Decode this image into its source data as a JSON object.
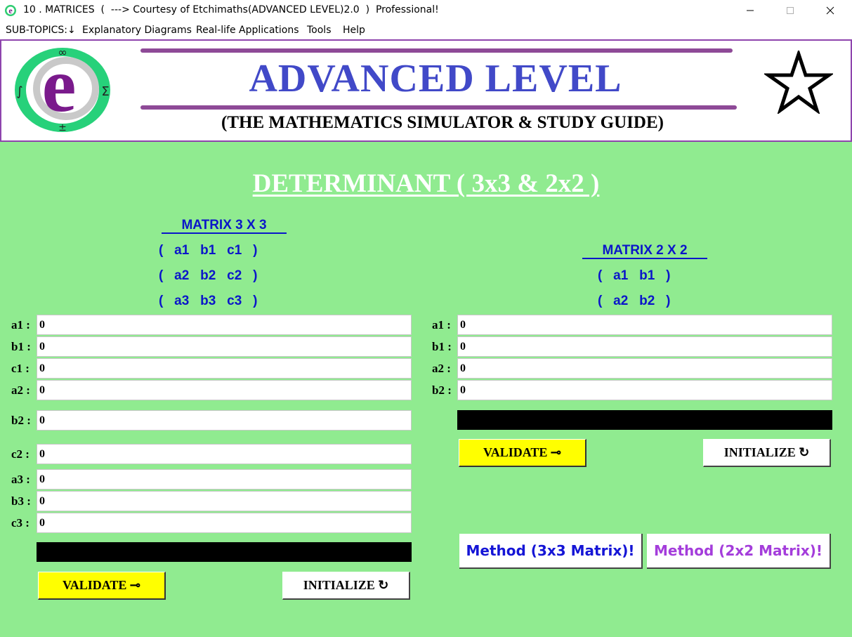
{
  "window": {
    "title": "10 . MATRICES  (  ---> Courtesy of Etchimaths(ADVANCED LEVEL)2.0  )  Professional!",
    "minimize_symbol": "—",
    "maximize_symbol": "☐",
    "close_symbol": "✕"
  },
  "menu": {
    "items": [
      "SUB-TOPICS:↓",
      "Explanatory Diagrams",
      "Real-life Applications",
      "Tools",
      "Help"
    ]
  },
  "banner": {
    "title": "ADVANCED LEVEL",
    "subtitle": "(THE MATHEMATICS SIMULATOR & STUDY GUIDE)",
    "logo_glyphs": {
      "top": "∞",
      "left": "∫",
      "right": "Σ",
      "bottom": "±",
      "center": "e"
    }
  },
  "page": {
    "title": "DETERMINANT ( 3x3 & 2x2 )"
  },
  "matrix3": {
    "heading": "MATRIX 3 X 3",
    "rows": [
      "(   a1   b1   c1   )",
      "(   a2   b2   c2   )",
      "(   a3   b3   c3   )"
    ],
    "fields": [
      {
        "label": "a1 :",
        "value": "0"
      },
      {
        "label": "b1 :",
        "value": "0"
      },
      {
        "label": "c1 :",
        "value": "0"
      },
      {
        "label": "a2 :",
        "value": "0"
      },
      {
        "label": "b2 :",
        "value": "0"
      },
      {
        "label": "c2 :",
        "value": "0"
      },
      {
        "label": "a3 :",
        "value": "0"
      },
      {
        "label": "b3 :",
        "value": "0"
      },
      {
        "label": "c3 :",
        "value": "0"
      }
    ],
    "result": "",
    "validate_label": "VALIDATE ⊸",
    "initialize_label": "INITIALIZE ↻"
  },
  "matrix2": {
    "heading": "MATRIX 2 X 2",
    "rows": [
      "(   a1   b1   )",
      "(   a2   b2   )"
    ],
    "fields": [
      {
        "label": "a1 :",
        "value": "0"
      },
      {
        "label": "b1 :",
        "value": "0"
      },
      {
        "label": "a2 :",
        "value": "0"
      },
      {
        "label": "b2 :",
        "value": "0"
      }
    ],
    "result": "",
    "validate_label": "VALIDATE ⊸",
    "initialize_label": "INITIALIZE ↻"
  },
  "methods": {
    "method3_label": "Method (3x3 Matrix)!",
    "method2_label": "Method (2x2 Matrix)!"
  },
  "colors": {
    "background_green": "#90eb90",
    "heading_blue": "#0b16c9",
    "banner_blue": "#4149c8",
    "rule_purple": "#8e4a97",
    "validate_yellow": "#ffff00",
    "method3_text": "#1515d6",
    "method2_text": "#a43ddb"
  }
}
